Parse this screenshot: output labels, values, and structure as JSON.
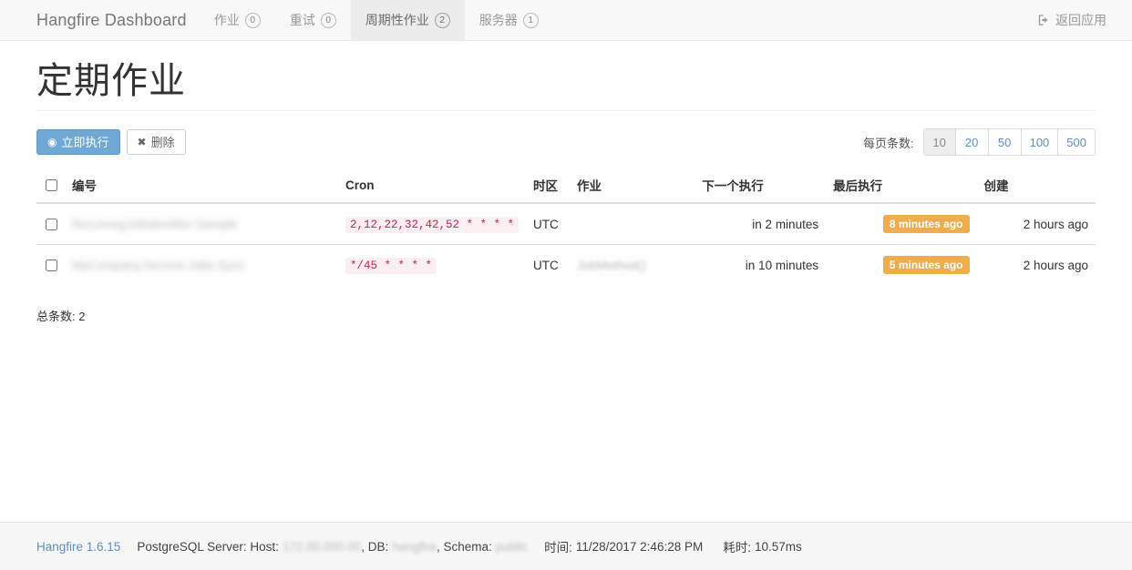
{
  "navbar": {
    "brand": "Hangfire Dashboard",
    "tabs": [
      {
        "label": "作业",
        "count": "0",
        "active": false
      },
      {
        "label": "重试",
        "count": "0",
        "active": false
      },
      {
        "label": "周期性作业",
        "count": "2",
        "active": true
      },
      {
        "label": "服务器",
        "count": "1",
        "active": false
      }
    ],
    "back_link": "返回应用",
    "back_icon": "sign-out-icon"
  },
  "page": {
    "title": "定期作业"
  },
  "toolbar": {
    "trigger_now_label": "立即执行",
    "trigger_now_icon": "play-circle-icon",
    "delete_label": "删除",
    "delete_icon": "times-icon",
    "per_page_label": "每页条数:",
    "per_page_options": [
      "10",
      "20",
      "50",
      "100",
      "500"
    ],
    "per_page_selected": "10"
  },
  "table": {
    "headers": {
      "id": "编号",
      "cron": "Cron",
      "timezone": "时区",
      "job": "作业",
      "next_execution": "下一个执行",
      "last_execution": "最后执行",
      "created": "创建"
    },
    "rows": [
      {
        "id": "",
        "id_redacted": "RecurringJobIdentifier:Sample",
        "cron": "2,12,22,32,42,52 * * * *",
        "timezone": "UTC",
        "job": "",
        "job_redacted": "",
        "next_execution": "in 2 minutes",
        "last_execution": "8 minutes ago",
        "created": "2 hours ago"
      },
      {
        "id": "",
        "id_redacted": "MyCompany.Service.Jobs.Sync",
        "cron": "*/45 * * * *",
        "timezone": "UTC",
        "job": "",
        "job_redacted": "JobMethod()",
        "next_execution": "in 10 minutes",
        "last_execution": "5 minutes ago",
        "created": "2 hours ago"
      }
    ],
    "total_label": "总条数: 2"
  },
  "footer": {
    "version": "Hangfire 1.6.15",
    "storage_prefix": "PostgreSQL Server: Host:",
    "host_redacted": "172.00.000.00",
    "db_prefix": ", DB:",
    "db_redacted": "hangfire",
    "schema_prefix": ", Schema:",
    "schema_redacted": "public",
    "time_label": "时间:",
    "time_value": "11/28/2017 2:46:28 PM",
    "elapsed_label": "耗时:",
    "elapsed_value": "10.57ms"
  },
  "colors": {
    "primary": "#6fa8d4",
    "warning_badge": "#f0ad4e",
    "code_text": "#c7254e",
    "code_bg": "#fbeff2",
    "link": "#5b8fc9",
    "navbar_bg": "#f8f8f8",
    "active_tab_bg": "#ececec"
  }
}
